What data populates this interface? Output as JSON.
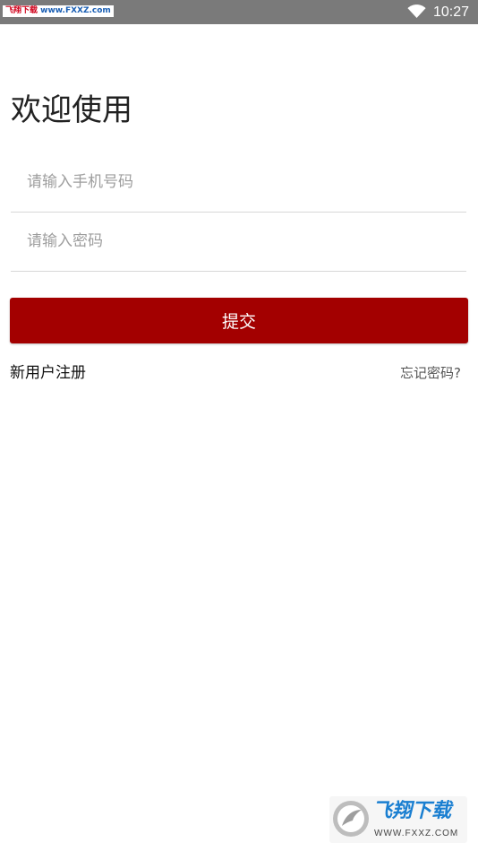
{
  "status_bar": {
    "watermark_site_name": "飞翔下载",
    "watermark_url": "www.FXXZ.com",
    "time": "10:27",
    "wifi_icon": "wifi-icon"
  },
  "login": {
    "title": "欢迎使用",
    "phone_placeholder": "请输入手机号码",
    "password_placeholder": "请输入密码",
    "submit_label": "提交",
    "register_label": "新用户注册",
    "forgot_label": "忘记密码?"
  },
  "corner_watermark": {
    "name": "飞翔下载",
    "url": "WWW.FXXZ.COM"
  },
  "colors": {
    "accent": "#a30000",
    "status_bar": "#7a7a7a",
    "divider": "#d8d8d8"
  }
}
